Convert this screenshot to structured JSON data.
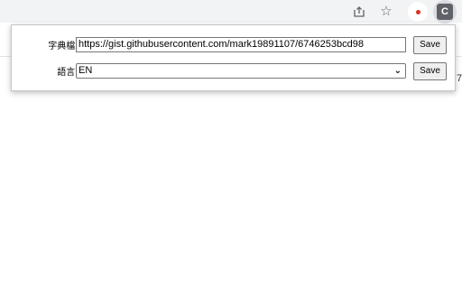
{
  "toolbar": {
    "icons": [
      "share-icon",
      "star-icon",
      "record-extension-icon",
      "c-extension-icon"
    ],
    "ext_c_letter": "C"
  },
  "popup": {
    "dictionary": {
      "label": "字典檔:",
      "value": "https://gist.githubusercontent.com/mark19891107/6746253bcd98",
      "save_label": "Save"
    },
    "language": {
      "label": "語言:",
      "selected": "EN",
      "save_label": "Save"
    }
  },
  "background_fragment": "7",
  "colors": {
    "toolbar_bg": "#f1f3f4",
    "record_dot": "#d93025",
    "ext_c_bg": "#5f6368"
  }
}
